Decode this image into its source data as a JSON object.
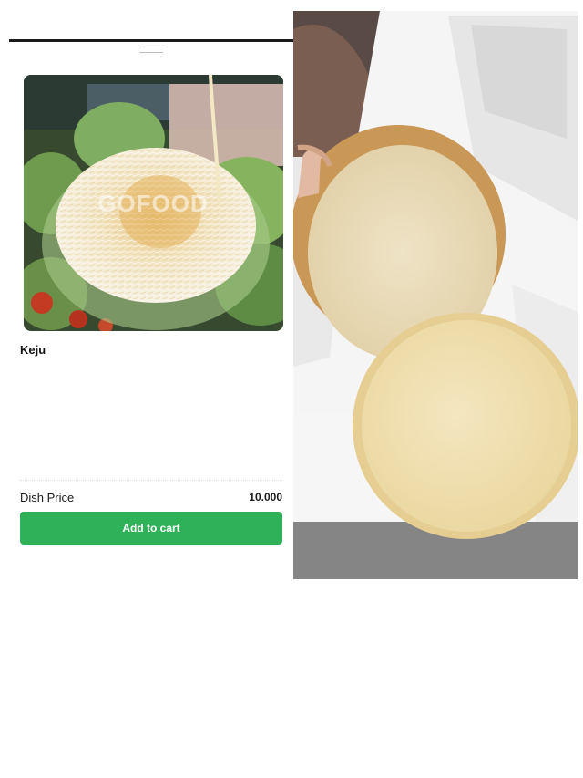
{
  "product": {
    "name": "Keju",
    "price_label": "Dish Price",
    "price_value": "10.000",
    "cta_label": "Add to cart",
    "photo_watermark": "GOFOOD"
  },
  "colors": {
    "accent": "#2fb157",
    "text": "#1a1a1a"
  }
}
